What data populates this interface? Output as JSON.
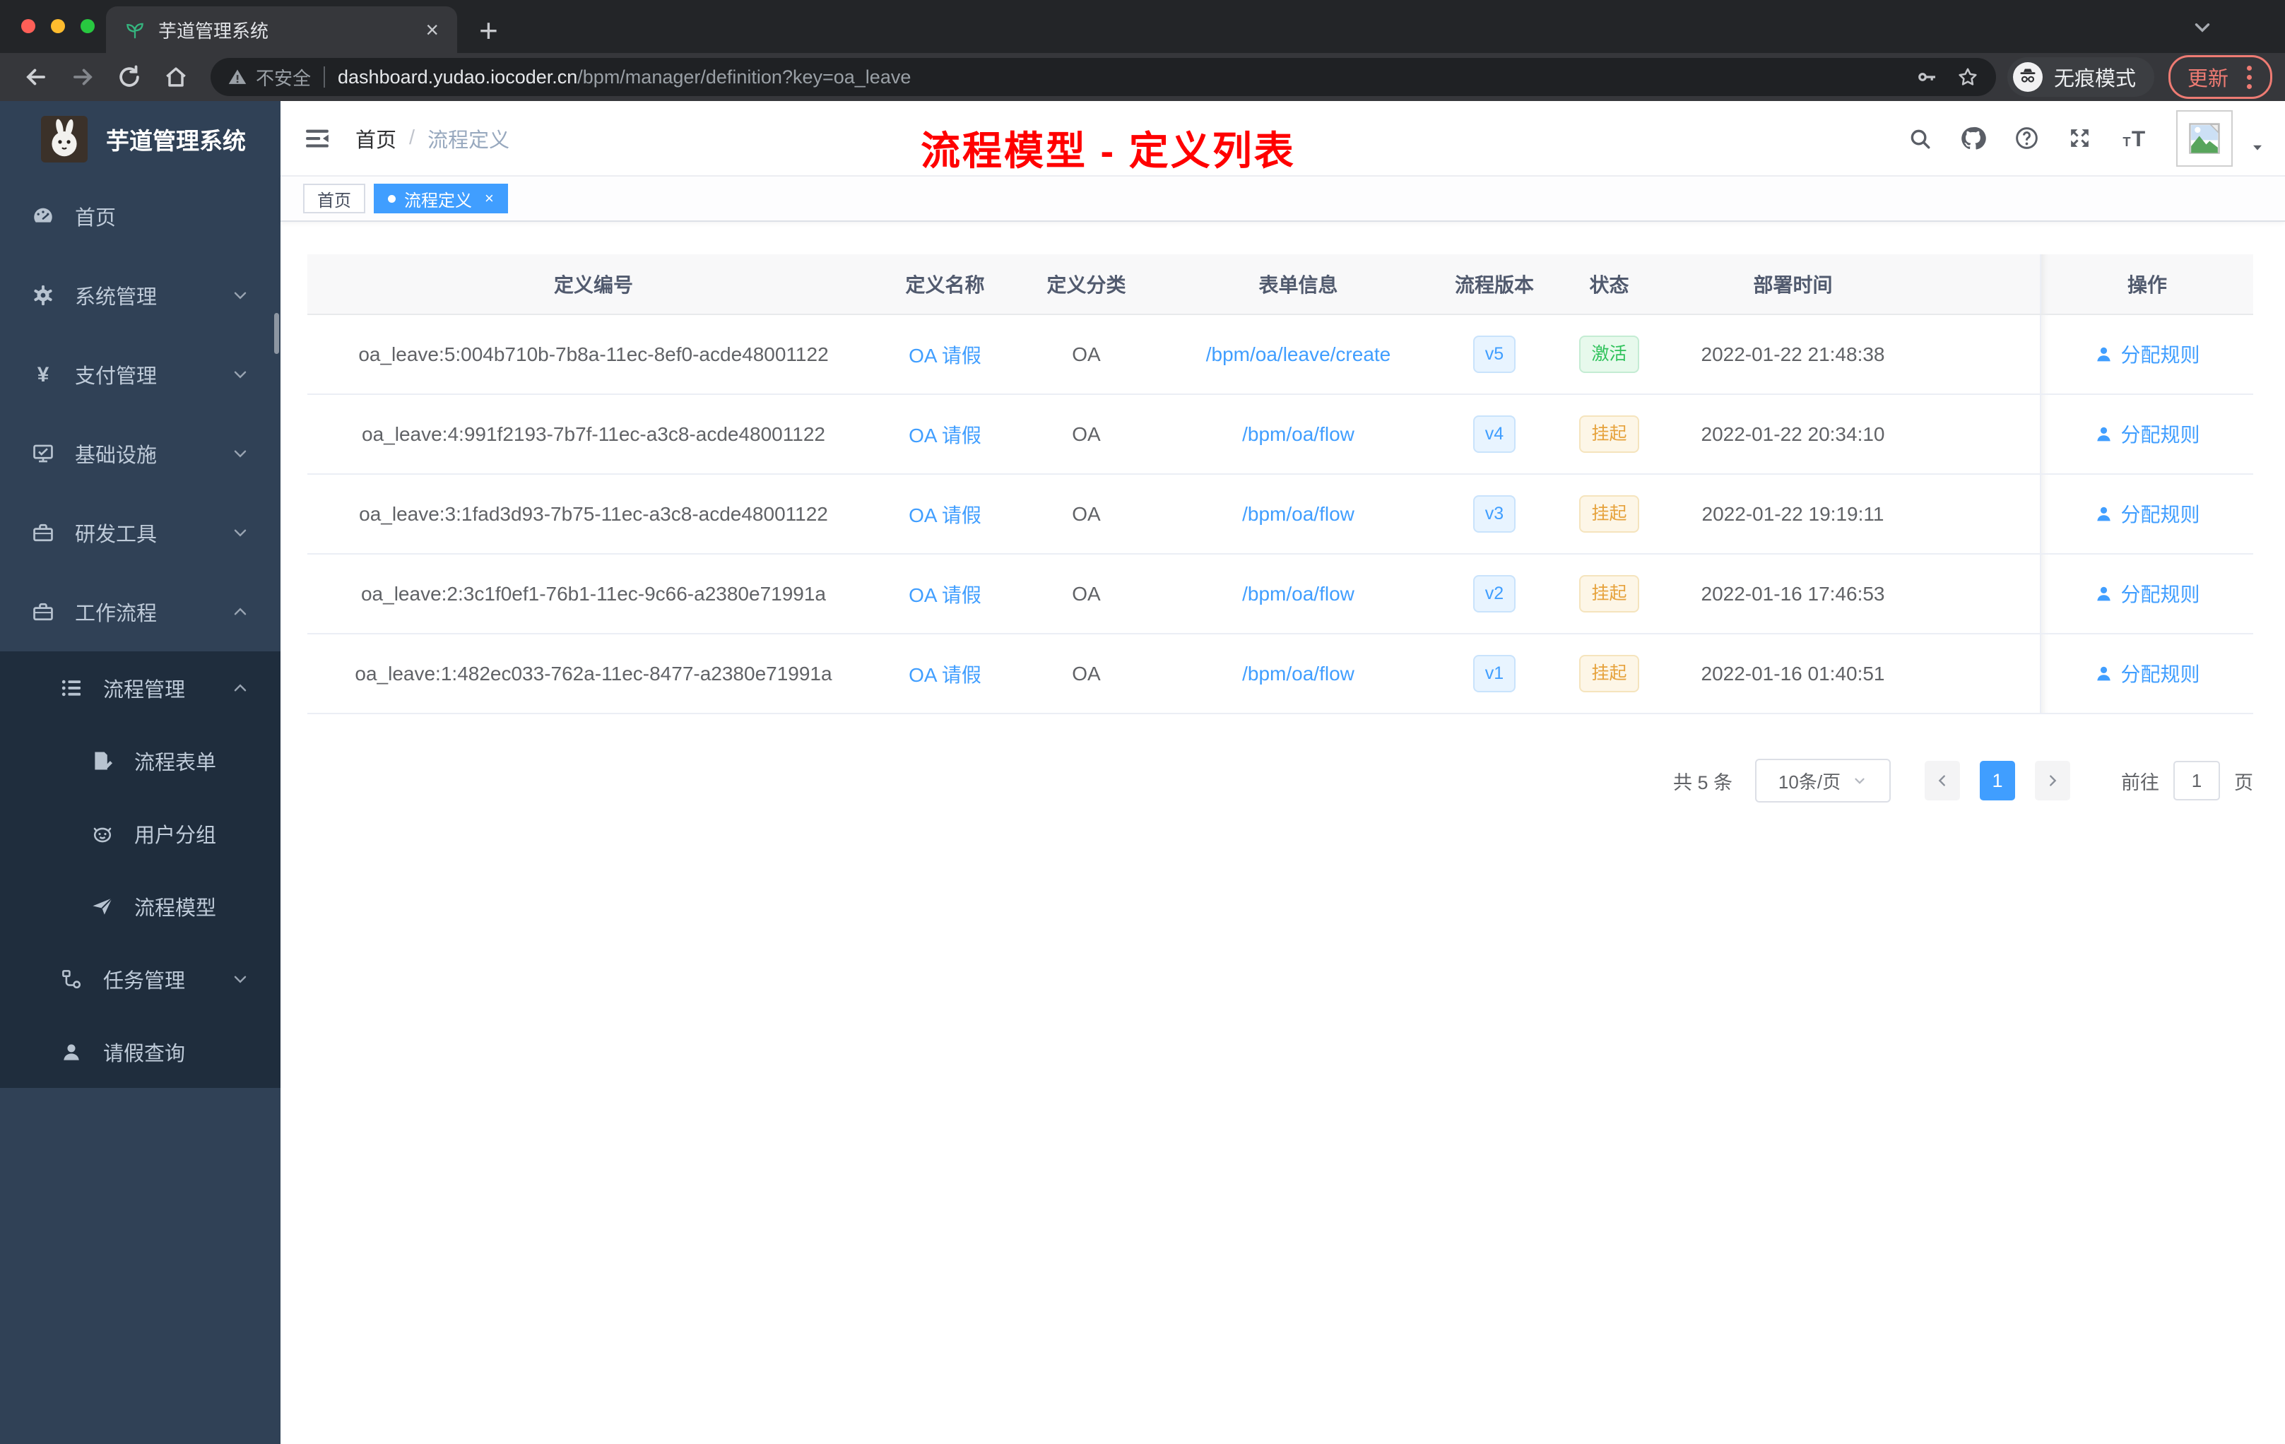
{
  "browser": {
    "tab_title": "芋道管理系统",
    "security_label": "不安全",
    "url_host": "dashboard.yudao.iocoder.cn",
    "url_path": "/bpm/manager/definition?key=oa_leave",
    "incognito_label": "无痕模式",
    "update_label": "更新"
  },
  "sidebar": {
    "app_title": "芋道管理系统",
    "items": [
      {
        "key": "home",
        "label": "首页",
        "icon": "dashboard-icon",
        "level": 1,
        "chevron": "",
        "dark": false
      },
      {
        "key": "system",
        "label": "系统管理",
        "icon": "gear-icon",
        "level": 1,
        "chevron": "down",
        "dark": false
      },
      {
        "key": "payment",
        "label": "支付管理",
        "icon": "yen-icon",
        "level": 1,
        "chevron": "down",
        "dark": false
      },
      {
        "key": "infrastructure",
        "label": "基础设施",
        "icon": "monitor-icon",
        "level": 1,
        "chevron": "down",
        "dark": false
      },
      {
        "key": "dev-tools",
        "label": "研发工具",
        "icon": "toolbox-icon",
        "level": 1,
        "chevron": "down",
        "dark": false
      },
      {
        "key": "workflow",
        "label": "工作流程",
        "icon": "toolbox-icon",
        "level": 1,
        "chevron": "up",
        "dark": false
      },
      {
        "key": "process-management",
        "label": "流程管理",
        "icon": "list-icon",
        "level": 2,
        "chevron": "up",
        "dark": true
      },
      {
        "key": "process-form",
        "label": "流程表单",
        "icon": "form-icon",
        "level": 3,
        "chevron": "",
        "dark": true
      },
      {
        "key": "user-group",
        "label": "用户分组",
        "icon": "robot-icon",
        "level": 3,
        "chevron": "",
        "dark": true
      },
      {
        "key": "process-model",
        "label": "流程模型",
        "icon": "paper-plane-icon",
        "level": 3,
        "chevron": "",
        "dark": true
      },
      {
        "key": "task-management",
        "label": "任务管理",
        "icon": "workflow-icon",
        "level": 2,
        "chevron": "down",
        "dark": true
      },
      {
        "key": "leave-query",
        "label": "请假查询",
        "icon": "user-icon",
        "level": 2,
        "chevron": "",
        "dark": true
      }
    ]
  },
  "header": {
    "breadcrumb_home": "首页",
    "breadcrumb_separator": "/",
    "breadcrumb_current": "流程定义",
    "annotation": "流程模型 - 定义列表"
  },
  "tags": [
    {
      "label": "首页",
      "active": false
    },
    {
      "label": "流程定义",
      "active": true
    }
  ],
  "table": {
    "columns": [
      "定义编号",
      "定义名称",
      "定义分类",
      "表单信息",
      "流程版本",
      "状态",
      "部署时间",
      "操作"
    ],
    "rows": [
      {
        "id": "oa_leave:5:004b710b-7b8a-11ec-8ef0-acde48001122",
        "name": "OA 请假",
        "category": "OA",
        "form": "/bpm/oa/leave/create",
        "version": "v5",
        "status": "激活",
        "status_type": "success",
        "deploy_time": "2022-01-22 21:48:38",
        "action": "分配规则"
      },
      {
        "id": "oa_leave:4:991f2193-7b7f-11ec-a3c8-acde48001122",
        "name": "OA 请假",
        "category": "OA",
        "form": "/bpm/oa/flow",
        "version": "v4",
        "status": "挂起",
        "status_type": "warning",
        "deploy_time": "2022-01-22 20:34:10",
        "action": "分配规则"
      },
      {
        "id": "oa_leave:3:1fad3d93-7b75-11ec-a3c8-acde48001122",
        "name": "OA 请假",
        "category": "OA",
        "form": "/bpm/oa/flow",
        "version": "v3",
        "status": "挂起",
        "status_type": "warning",
        "deploy_time": "2022-01-22 19:19:11",
        "action": "分配规则"
      },
      {
        "id": "oa_leave:2:3c1f0ef1-76b1-11ec-9c66-a2380e71991a",
        "name": "OA 请假",
        "category": "OA",
        "form": "/bpm/oa/flow",
        "version": "v2",
        "status": "挂起",
        "status_type": "warning",
        "deploy_time": "2022-01-16 17:46:53",
        "action": "分配规则"
      },
      {
        "id": "oa_leave:1:482ec033-762a-11ec-8477-a2380e71991a",
        "name": "OA 请假",
        "category": "OA",
        "form": "/bpm/oa/flow",
        "version": "v1",
        "status": "挂起",
        "status_type": "warning",
        "deploy_time": "2022-01-16 01:40:51",
        "action": "分配规则"
      }
    ]
  },
  "pagination": {
    "total_label": "共 5 条",
    "page_size": "10条/页",
    "current_page": "1",
    "jump_prefix": "前往",
    "jump_value": "1",
    "jump_suffix": "页"
  },
  "colors": {
    "accent": "#409eff",
    "sidebar_bg": "#304156",
    "submenu_bg": "#1f2d3d",
    "success": "#2fc25b",
    "warning": "#e6a23c",
    "annotation_red": "#ff0000",
    "chrome_update_red": "#ee7b73"
  }
}
